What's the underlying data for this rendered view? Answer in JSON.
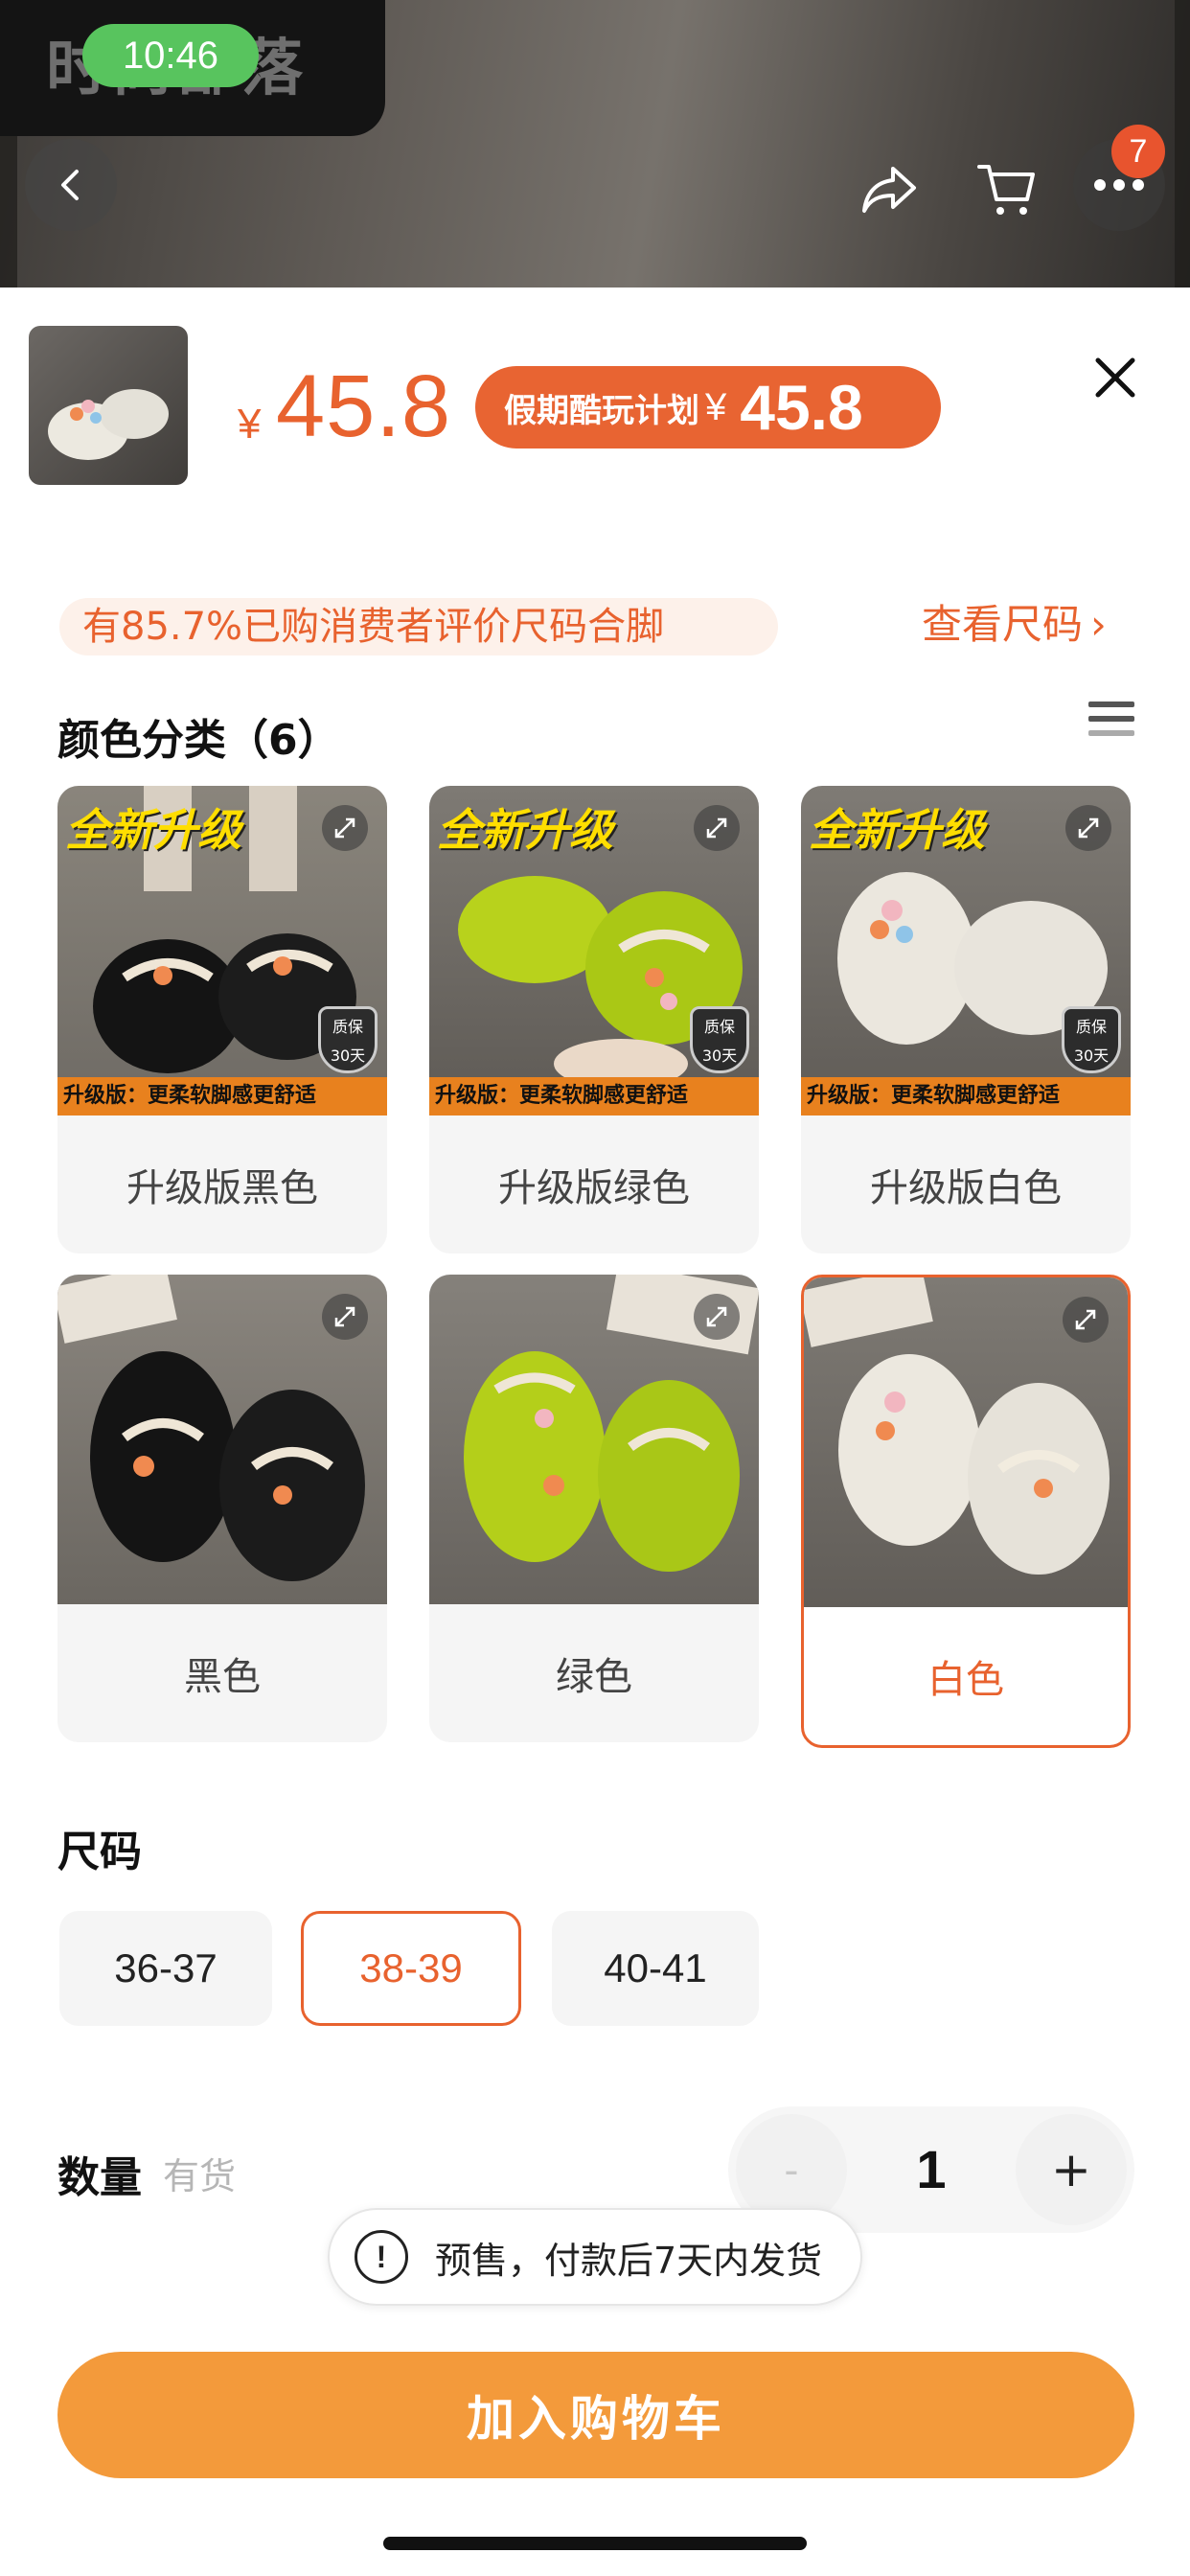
{
  "status_bar": {
    "time": "10:46"
  },
  "header": {
    "shop_name": "时尚部落",
    "cart_badge_count": "7",
    "icons": [
      "back-icon",
      "share-icon",
      "cart-icon",
      "more-icon"
    ]
  },
  "product": {
    "currency_symbol": "¥",
    "price": "45.8",
    "promo": {
      "label": "假期酷玩计划",
      "currency_symbol": "¥",
      "price": "45.8"
    }
  },
  "fit_banner": "有85.7%已购消费者评价尺码合脚",
  "size_guide_link": "查看尺码",
  "color_section": {
    "title": "颜色分类（6）",
    "options": [
      {
        "label": "升级版黑色",
        "upgrade_badge": "全新升级",
        "bottom_text": "升级版：更柔软脚感更舒适",
        "warranty": "质保 30天",
        "selected": false
      },
      {
        "label": "升级版绿色",
        "upgrade_badge": "全新升级",
        "bottom_text": "升级版：更柔软脚感更舒适",
        "warranty": "质保 30天",
        "selected": false
      },
      {
        "label": "升级版白色",
        "upgrade_badge": "全新升级",
        "bottom_text": "升级版：更柔软脚感更舒适",
        "warranty": "质保 30天",
        "selected": false
      },
      {
        "label": "黑色",
        "selected": false
      },
      {
        "label": "绿色",
        "selected": false
      },
      {
        "label": "白色",
        "selected": true
      }
    ]
  },
  "size_section": {
    "title": "尺码",
    "options": [
      {
        "label": "36-37",
        "selected": false
      },
      {
        "label": "38-39",
        "selected": true
      },
      {
        "label": "40-41",
        "selected": false
      }
    ]
  },
  "quantity_section": {
    "title": "数量",
    "stock": "有货",
    "value": "1",
    "minus": "-",
    "plus": "+"
  },
  "toast": {
    "icon": "!",
    "text": "预售，付款后7天内发货"
  },
  "cta": {
    "label": "加入购物车"
  },
  "colors": {
    "accent": "#e8622e",
    "cta": "#f39a3b",
    "status_pill": "#58c45e"
  }
}
